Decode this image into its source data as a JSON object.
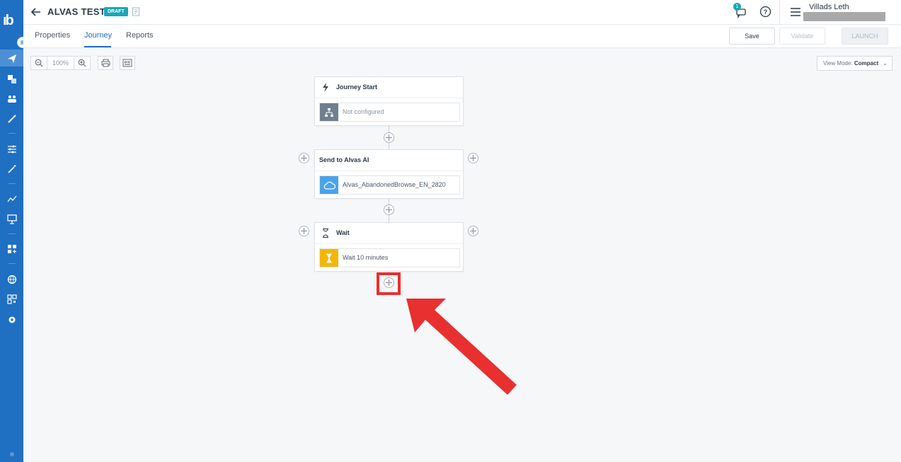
{
  "rail": {
    "logo": "ıb",
    "icons": [
      "send-icon",
      "pages-icon",
      "audience-icon",
      "brush-icon",
      "sliders-icon",
      "magic-wand-icon",
      "analytics-icon",
      "presentation-icon",
      "apps-icon",
      "globe-icon",
      "qr-code-icon",
      "settings-icon"
    ]
  },
  "header": {
    "title": "ALVAS TEST ·",
    "status_badge": "DRAFT",
    "notifications_count": "1",
    "user_name": "Villads Leth"
  },
  "tabs": [
    {
      "label": "Properties",
      "active": false
    },
    {
      "label": "Journey",
      "active": true
    },
    {
      "label": "Reports",
      "active": false
    }
  ],
  "actions": {
    "save": "Save",
    "validate": "Validate",
    "launch": "LAUNCH"
  },
  "toolbar": {
    "zoom": "100%",
    "view_mode_label": "View Mode:",
    "view_mode_value": "Compact"
  },
  "journey": {
    "start": {
      "title": "Journey Start",
      "item": "Not configured"
    },
    "send": {
      "title": "Send to Alvas AI",
      "item": "Alvas_AbandonedBrowse_EN_2820"
    },
    "wait": {
      "title": "Wait",
      "item": "Wait 10 minutes"
    }
  },
  "colors": {
    "rail": "#1f6fc2",
    "accent": "#1aa7b8",
    "highlight": "#e83030",
    "send_icon_bg": "#4aa3e8",
    "wait_icon_bg": "#f2b705",
    "start_icon_bg": "#6f7f90"
  }
}
